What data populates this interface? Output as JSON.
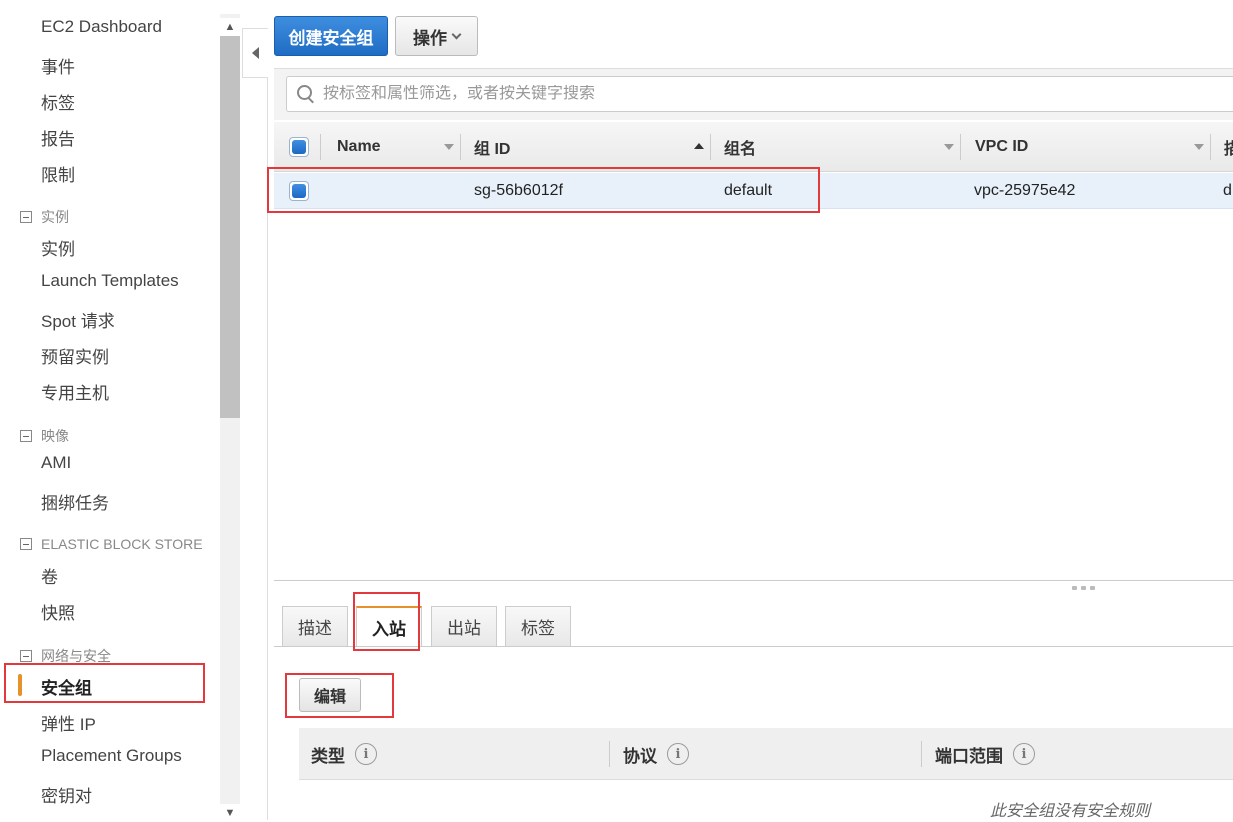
{
  "sidebar": {
    "top_links": [
      "EC2 Dashboard",
      "事件",
      "标签",
      "报告",
      "限制"
    ],
    "sections": [
      {
        "title": "实例",
        "items": [
          "实例",
          "Launch Templates",
          "Spot 请求",
          "预留实例",
          "专用主机"
        ]
      },
      {
        "title": "映像",
        "items": [
          "AMI",
          "捆绑任务"
        ]
      },
      {
        "title": "ELASTIC BLOCK STORE",
        "items": [
          "卷",
          "快照"
        ]
      },
      {
        "title": "网络与安全",
        "items": [
          "安全组",
          "弹性 IP",
          "Placement Groups",
          "密钥对"
        ]
      }
    ],
    "active_item": "安全组",
    "active_color": "#e7912a"
  },
  "toolbar": {
    "create_label": "创建安全组",
    "actions_label": "操作"
  },
  "search": {
    "placeholder": "按标签和属性筛选，或者按关键字搜索",
    "value": ""
  },
  "table": {
    "columns": [
      "Name",
      "组 ID",
      "组名",
      "VPC ID",
      "描"
    ],
    "sorted_column": "组 ID",
    "rows": [
      {
        "name": "",
        "group_id": "sg-56b6012f",
        "group_name": "default",
        "vpc_id": "vpc-25975e42",
        "desc": "d",
        "selected": true
      }
    ]
  },
  "detail_tabs": [
    "描述",
    "入站",
    "出站",
    "标签"
  ],
  "active_tab": "入站",
  "inbound": {
    "edit_label": "编辑",
    "columns": [
      "类型",
      "协议",
      "端口范围"
    ],
    "empty_message": "此安全组没有安全规则"
  },
  "colors": {
    "primary": "#1f6cc4",
    "highlight": "#e4393c",
    "accent": "#e7912a"
  }
}
